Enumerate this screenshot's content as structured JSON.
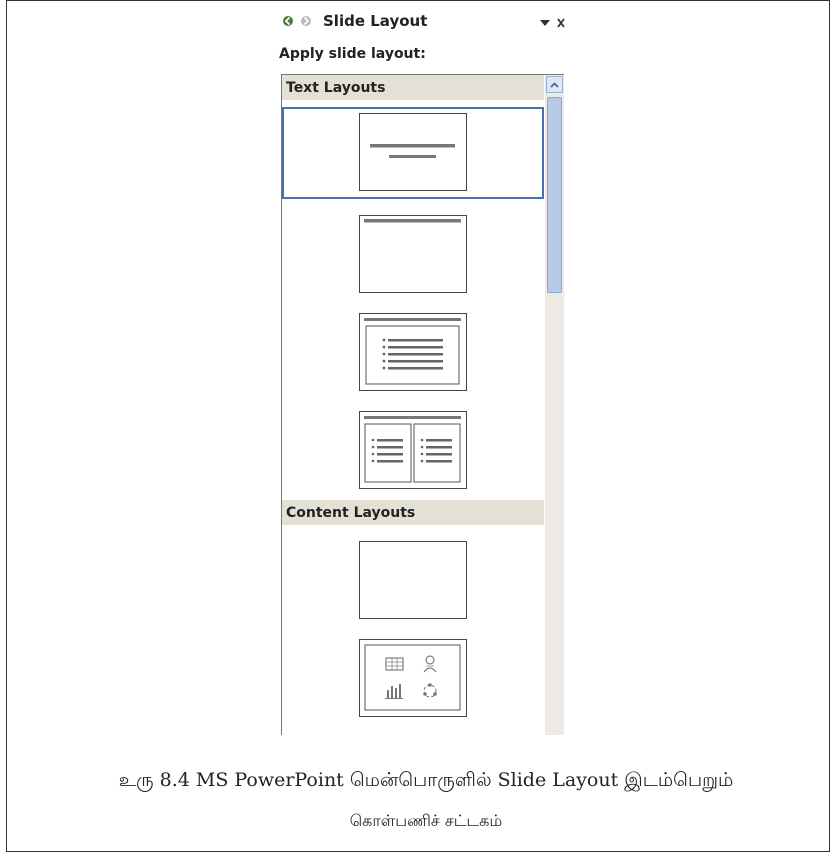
{
  "pane": {
    "title": "Slide Layout",
    "apply_label": "Apply slide layout:",
    "groups": [
      {
        "label": "Text Layouts"
      },
      {
        "label": "Content Layouts"
      }
    ]
  },
  "caption": {
    "line1": "உரு 8.4  MS PowerPoint  மென்பொருளில்  Slide Layout இடம்பெறும்",
    "line2": "கொள்பணிச் சட்டகம்"
  },
  "colors": {
    "selection": "#4a6faf",
    "group_header_bg": "#e3e1d5",
    "scroll_thumb": "#b8cbe6"
  },
  "icons": [
    "back-arrow-icon",
    "forward-arrow-icon",
    "dropdown-arrow-icon",
    "close-icon",
    "scroll-up-icon"
  ]
}
